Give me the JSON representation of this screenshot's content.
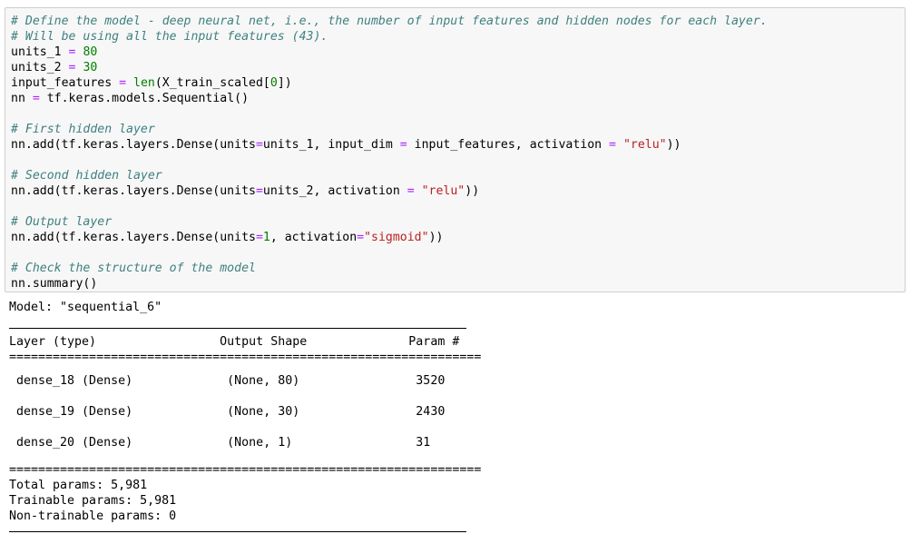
{
  "notebook": {
    "cell_type": "code",
    "input_cell": {
      "name": "python-code-cell",
      "lines": [
        [
          {
            "t": "comment",
            "s": "# Define the model - deep neural net, i.e., the number of input features and hidden nodes for each layer."
          }
        ],
        [
          {
            "t": "comment",
            "s": "# Will be using all the input features (43)."
          }
        ],
        [
          {
            "t": "plain",
            "s": "units_1 "
          },
          {
            "t": "operator",
            "s": "="
          },
          {
            "t": "plain",
            "s": " "
          },
          {
            "t": "number",
            "s": "80"
          }
        ],
        [
          {
            "t": "plain",
            "s": "units_2 "
          },
          {
            "t": "operator",
            "s": "="
          },
          {
            "t": "plain",
            "s": " "
          },
          {
            "t": "number",
            "s": "30"
          }
        ],
        [
          {
            "t": "plain",
            "s": "input_features "
          },
          {
            "t": "operator",
            "s": "="
          },
          {
            "t": "plain",
            "s": " "
          },
          {
            "t": "builtin",
            "s": "len"
          },
          {
            "t": "plain",
            "s": "(X_train_scaled["
          },
          {
            "t": "number",
            "s": "0"
          },
          {
            "t": "plain",
            "s": "])"
          }
        ],
        [
          {
            "t": "plain",
            "s": "nn "
          },
          {
            "t": "operator",
            "s": "="
          },
          {
            "t": "plain",
            "s": " tf.keras.models.Sequential()"
          }
        ],
        [],
        [
          {
            "t": "comment",
            "s": "# First hidden layer"
          }
        ],
        [
          {
            "t": "plain",
            "s": "nn.add(tf.keras.layers.Dense(units"
          },
          {
            "t": "operator",
            "s": "="
          },
          {
            "t": "plain",
            "s": "units_1, input_dim "
          },
          {
            "t": "operator",
            "s": "="
          },
          {
            "t": "plain",
            "s": " input_features, activation "
          },
          {
            "t": "operator",
            "s": "="
          },
          {
            "t": "plain",
            "s": " "
          },
          {
            "t": "string",
            "s": "\"relu\""
          },
          {
            "t": "plain",
            "s": "))"
          }
        ],
        [],
        [
          {
            "t": "comment",
            "s": "# Second hidden layer"
          }
        ],
        [
          {
            "t": "plain",
            "s": "nn.add(tf.keras.layers.Dense(units"
          },
          {
            "t": "operator",
            "s": "="
          },
          {
            "t": "plain",
            "s": "units_2, activation "
          },
          {
            "t": "operator",
            "s": "="
          },
          {
            "t": "plain",
            "s": " "
          },
          {
            "t": "string",
            "s": "\"relu\""
          },
          {
            "t": "plain",
            "s": "))"
          }
        ],
        [],
        [
          {
            "t": "comment",
            "s": "# Output layer"
          }
        ],
        [
          {
            "t": "plain",
            "s": "nn.add(tf.keras.layers.Dense(units"
          },
          {
            "t": "operator",
            "s": "="
          },
          {
            "t": "number",
            "s": "1"
          },
          {
            "t": "plain",
            "s": ", activation"
          },
          {
            "t": "operator",
            "s": "="
          },
          {
            "t": "string",
            "s": "\"sigmoid\""
          },
          {
            "t": "plain",
            "s": "))"
          }
        ],
        [],
        [
          {
            "t": "comment",
            "s": "# Check the structure of the model"
          }
        ],
        [
          {
            "t": "plain",
            "s": "nn.summary()"
          }
        ]
      ]
    },
    "output_cell": {
      "name": "model-summary-output",
      "model_line": "Model: \"sequential_6\"",
      "header_row": "Layer (type)                 Output Shape              Param #   ",
      "separator_equals": "=================================================================",
      "layer_rows": [
        " dense_18 (Dense)             (None, 80)                3520      ",
        " dense_19 (Dense)             (None, 30)                2430      ",
        " dense_20 (Dense)             (None, 1)                 31        "
      ],
      "totals": [
        "Total params: 5,981",
        "Trainable params: 5,981",
        "Non-trainable params: 0"
      ]
    }
  },
  "colors": {
    "comment": "#408080",
    "string": "#ba2121",
    "number": "#008000",
    "builtin": "#008000",
    "operator": "#aa22ff",
    "cell_background": "#f7f7f7",
    "cell_border": "#cfcfcf",
    "text": "#000000"
  }
}
